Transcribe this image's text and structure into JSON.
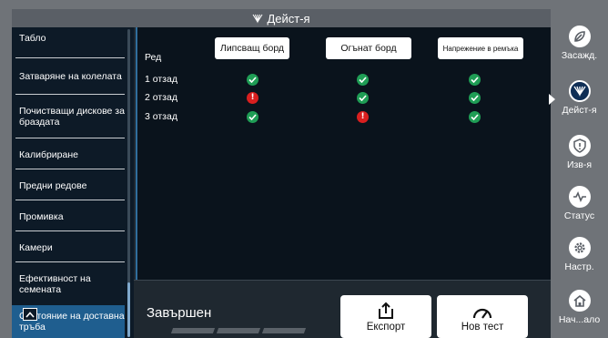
{
  "titlebar": {
    "title": "Дейст-я",
    "icon": "actions-icon"
  },
  "menu": {
    "items": [
      {
        "label": "Табло"
      },
      {
        "label": "Затваряне на колелата"
      },
      {
        "label": "Почистващи дискове за браздата"
      },
      {
        "label": "Калибриране"
      },
      {
        "label": "Предни редове"
      },
      {
        "label": "Промивка"
      },
      {
        "label": "Камери"
      },
      {
        "label": "Ефективност на семената"
      },
      {
        "label": "Състояние на доставна тръба",
        "active": true
      }
    ]
  },
  "table": {
    "row_header": "Ред",
    "columns": [
      "Липсващ борд",
      "Огънат борд",
      "Напрежение в ремъка"
    ],
    "rows": [
      {
        "label": "1 отзад",
        "status": [
          "ok",
          "ok",
          "ok"
        ]
      },
      {
        "label": "2 отзад",
        "status": [
          "error",
          "ok",
          "ok"
        ]
      },
      {
        "label": "3 отзад",
        "status": [
          "ok",
          "error",
          "ok"
        ]
      }
    ],
    "colors": {
      "ok": "#1f9d55",
      "error": "#d91f1f"
    }
  },
  "footer": {
    "status": "Завършен",
    "export_label": "Експорт",
    "new_test_label": "Нов тест",
    "export_icon": "share-icon",
    "new_test_icon": "gauge-icon"
  },
  "nav": {
    "items": [
      {
        "label": "Засажд.",
        "icon": "seed-icon"
      },
      {
        "label": "Дейст-я",
        "icon": "actions-icon",
        "active": true
      },
      {
        "label": "Изв-я",
        "icon": "alert-shield-icon"
      },
      {
        "label": "Статус",
        "icon": "pulse-icon"
      },
      {
        "label": "Настр.",
        "icon": "gear-icon"
      },
      {
        "label": "Нач...ало",
        "icon": "home-icon"
      }
    ]
  }
}
